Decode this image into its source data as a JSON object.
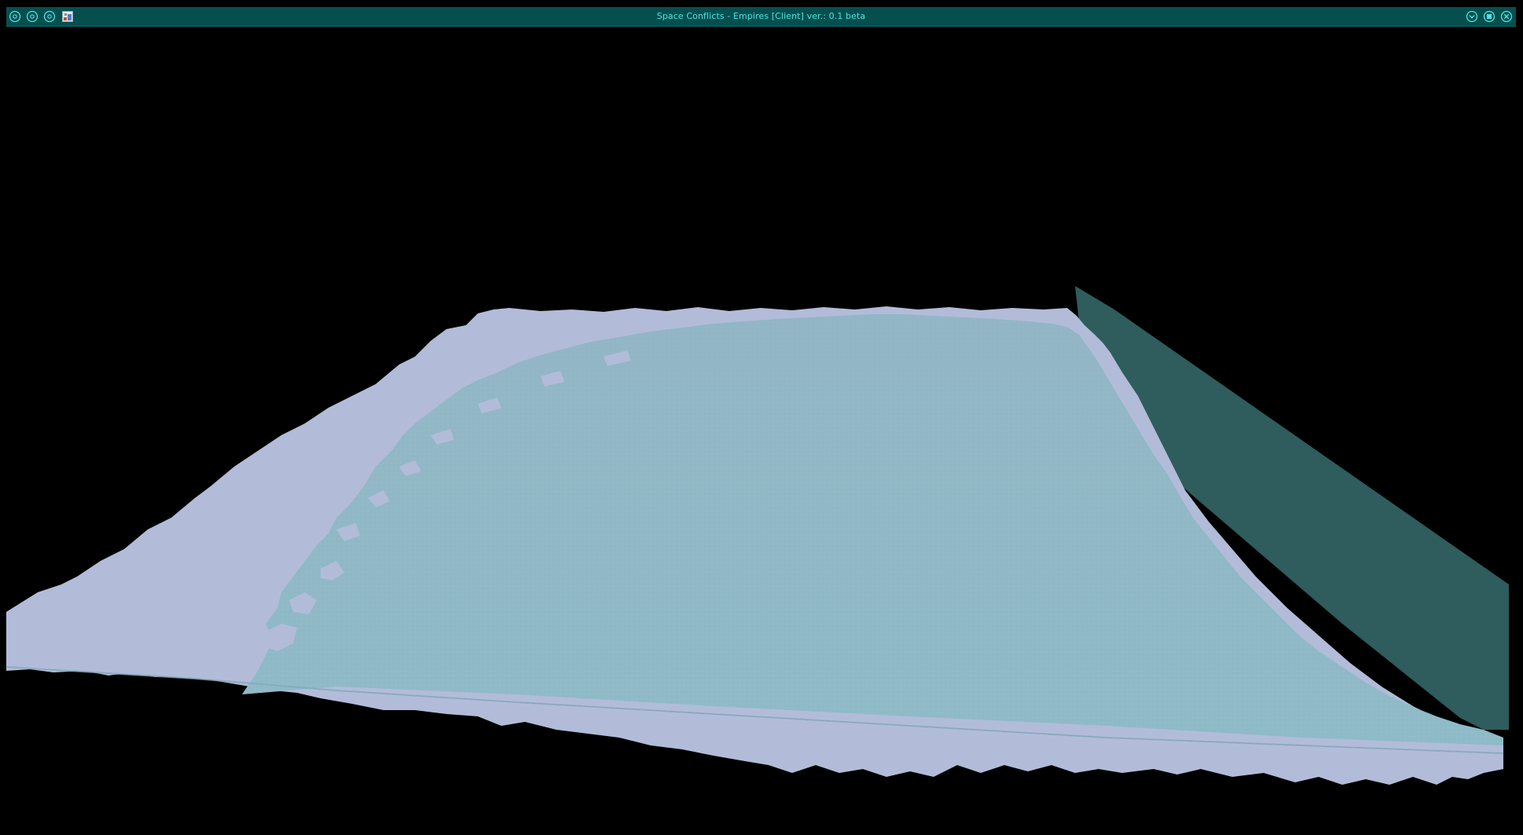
{
  "window": {
    "title": "Space Conflicts - Empires [Client] ver.: 0.1 beta"
  },
  "title_bar": {
    "left_buttons": [
      {
        "icon": "circle-dot-icon"
      },
      {
        "icon": "circle-dot-icon"
      },
      {
        "icon": "circle-dot-icon"
      },
      {
        "icon": "app-image-icon"
      }
    ],
    "right_buttons": [
      {
        "icon": "minimize-chevron-icon"
      },
      {
        "icon": "maximize-square-icon"
      },
      {
        "icon": "close-x-icon"
      }
    ]
  },
  "colors": {
    "title_bar_bg": "#064f4f",
    "title_text": "#4fe3e3",
    "icon_stroke": "#4fe3e3",
    "background": "#000000",
    "terrain_snow": "#b2bcd9",
    "terrain_water": "#8fb9c6",
    "terrain_shadow": "#2f5c5c"
  },
  "scene": {
    "description_kind": "3d-terrain-viewport"
  }
}
